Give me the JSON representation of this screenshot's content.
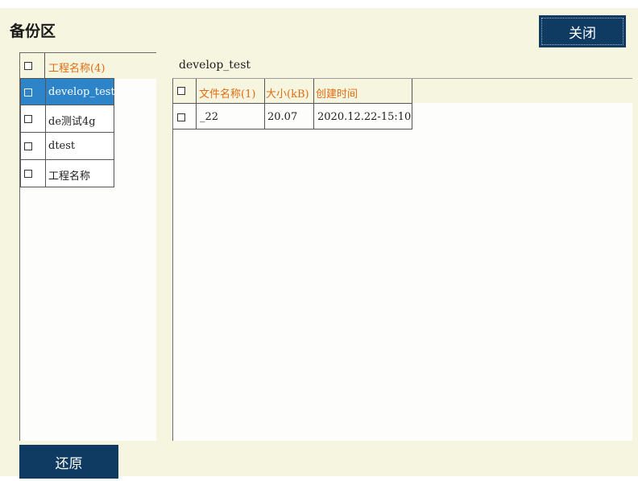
{
  "window": {
    "title": "备份区"
  },
  "buttons": {
    "close": "关闭",
    "restore": "还原"
  },
  "projects": {
    "header": "工程名称(4)",
    "items": [
      {
        "label": "develop_test",
        "selected": true
      },
      {
        "label": "de测试4g",
        "selected": false
      },
      {
        "label": "dtest",
        "selected": false
      },
      {
        "label": "工程名称",
        "selected": false
      }
    ]
  },
  "files": {
    "project_name": "develop_test",
    "columns": [
      "文件名称(1)",
      "大小(kB)",
      "创建时间"
    ],
    "rows": [
      {
        "name": "_22",
        "size": "20.07",
        "created": "2020.12.22-15:10"
      }
    ]
  },
  "colors": {
    "accent": "#e36b0f",
    "button": "#0f3b63",
    "selection": "#2d84c9",
    "panel_bg": "#f6f5e0"
  }
}
